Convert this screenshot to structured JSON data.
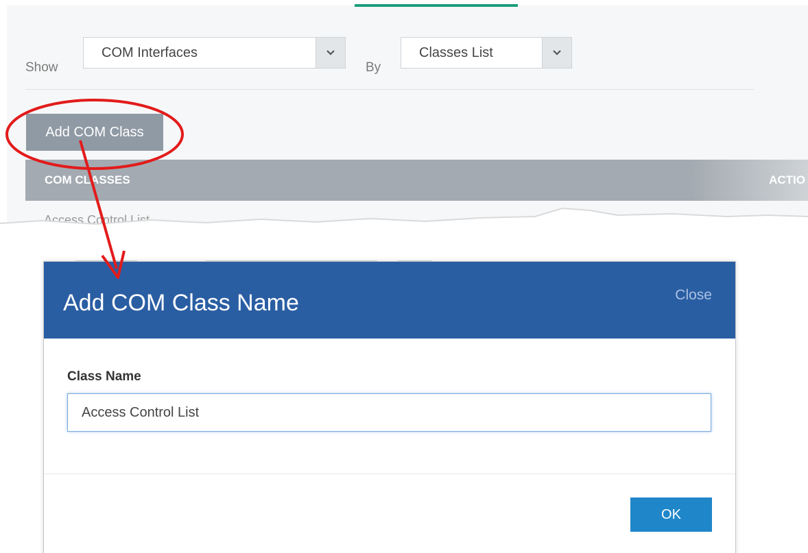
{
  "filters": {
    "show_label": "Show",
    "show_value": "COM Interfaces",
    "by_label": "By",
    "by_value": "Classes List"
  },
  "toolbar": {
    "add_button_label": "Add COM Class"
  },
  "table": {
    "columns": [
      "COM CLASSES",
      "ACTIO"
    ],
    "rows": [
      "Access Control List"
    ]
  },
  "dialog": {
    "title": "Add COM Class Name",
    "close_label": "Close",
    "field_label": "Class Name",
    "field_value": "Access Control List",
    "ok_label": "OK"
  },
  "colors": {
    "dialog_header": "#2a5ea3",
    "ok_button": "#1f86c9",
    "annotation": "#e21b1b",
    "tab_accent": "#1e9e7e"
  },
  "icons": {
    "select_arrow": "chevron-down-icon"
  }
}
